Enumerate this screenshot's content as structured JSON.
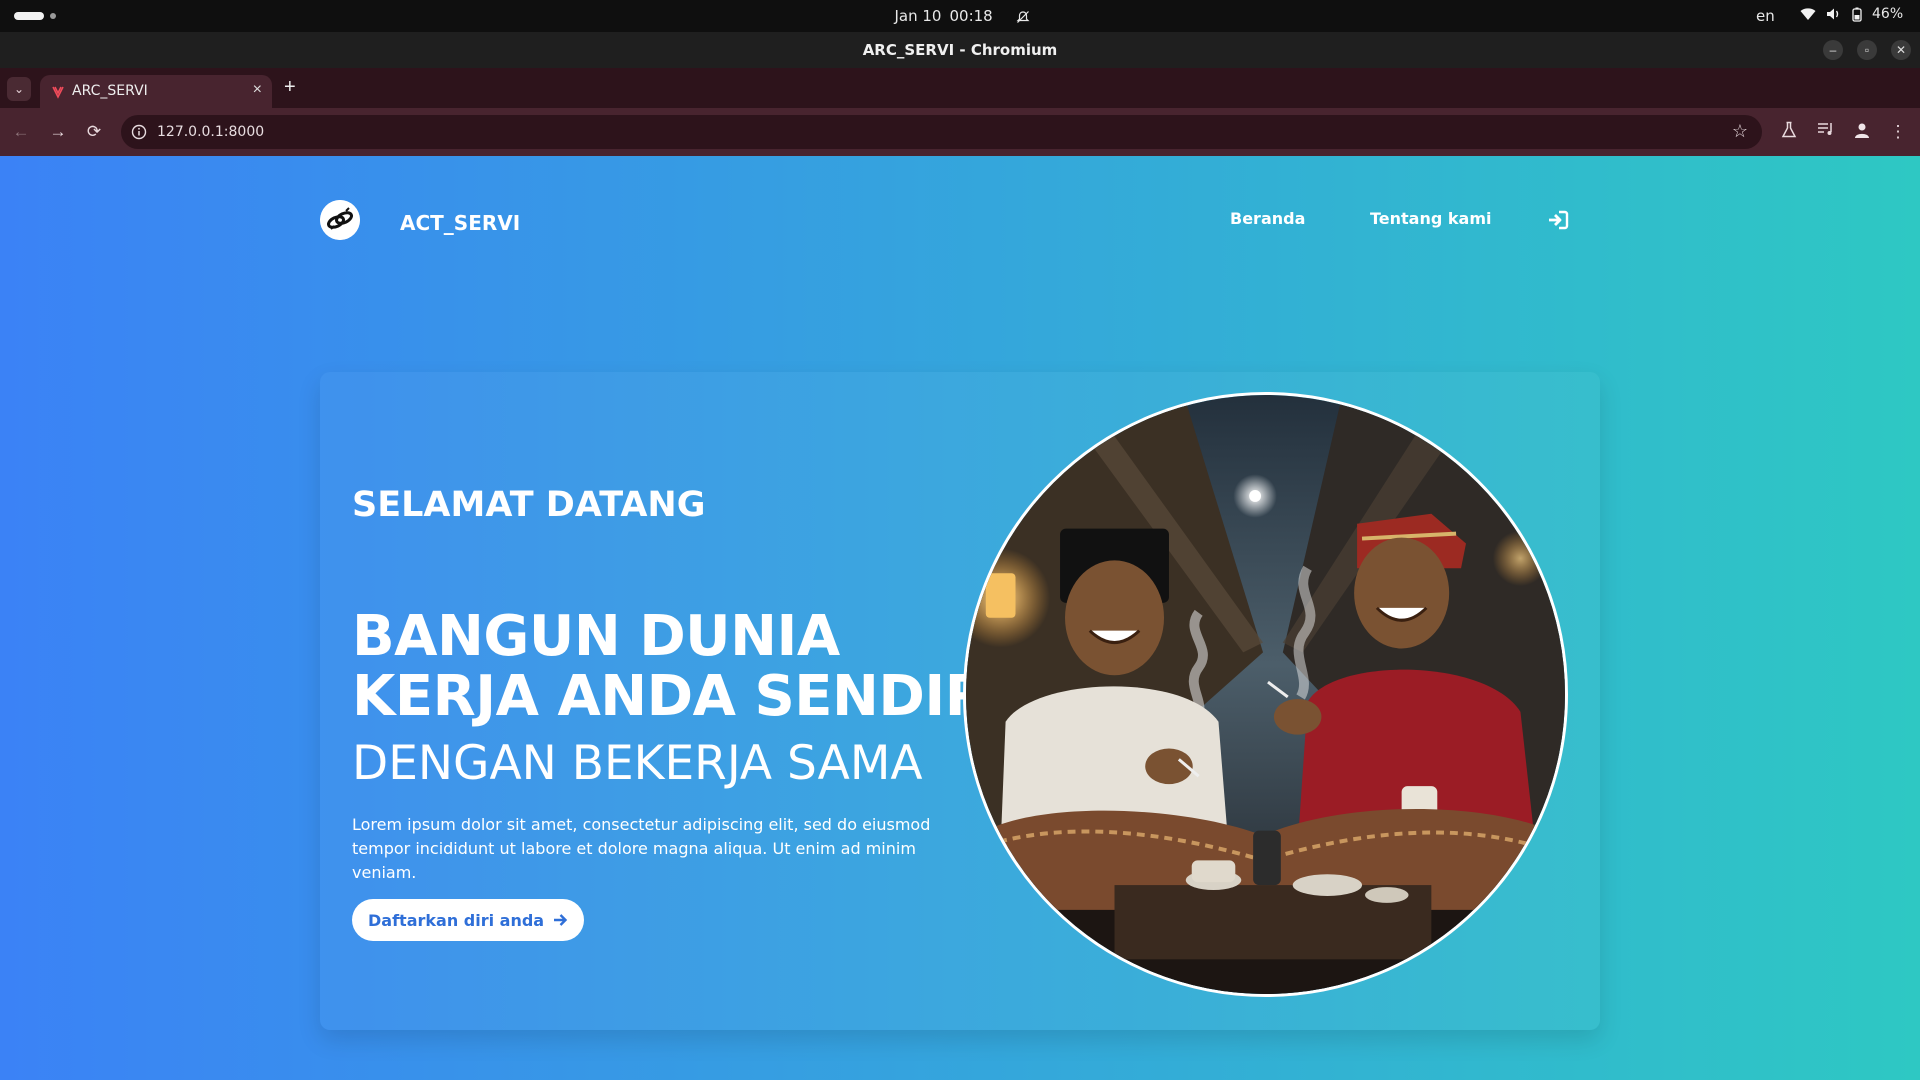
{
  "os": {
    "date": "Jan 10",
    "time": "00:18",
    "language": "en",
    "battery": "46%",
    "icons": [
      "notifications-muted-icon",
      "wifi-icon",
      "volume-icon",
      "battery-icon"
    ]
  },
  "browser": {
    "window_title": "ARC_SERVI - Chromium",
    "tab_title": "ARC_SERVI",
    "url": "127.0.0.1:8000"
  },
  "site": {
    "brand": "ACT_SERVI",
    "nav": {
      "home": "Beranda",
      "about": "Tentang kami"
    },
    "hero": {
      "welcome": "SELAMAT DATANG",
      "headline_line1": "BANGUN DUNIA",
      "headline_line2": "KERJA ANDA SENDIRI",
      "subheadline": "DENGAN BEKERJA SAMA",
      "description": "Lorem ipsum dolor sit amet, consectetur adipiscing elit, sed do eiusmod tempor incididunt ut labore et dolore magna aliqua. Ut enim ad minim veniam.",
      "cta_label": "Daftarkan diri anda"
    }
  },
  "colors": {
    "gradient_start": "#3b82f6",
    "gradient_end": "#2ec8c3",
    "tab_strip": "#2d131b",
    "toolbar": "#48242f",
    "cta_text": "#2f6fd8"
  }
}
